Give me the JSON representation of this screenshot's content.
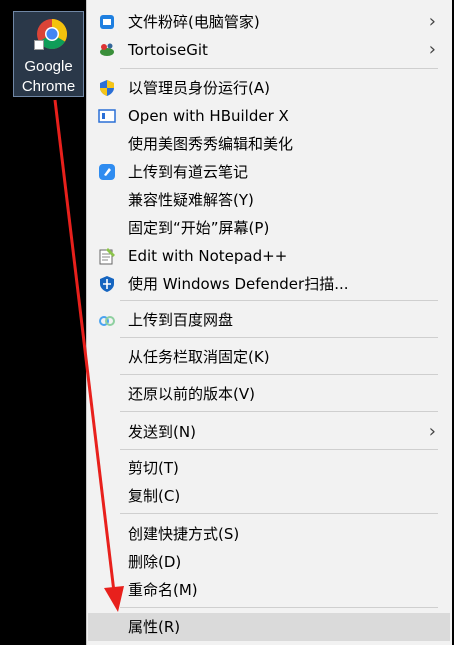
{
  "desktop": {
    "shortcut_label_line1": "Google",
    "shortcut_label_line2": "Chrome",
    "shortcut_icon": "chrome-icon"
  },
  "menu": {
    "items": [
      {
        "label": "文件粉碎(电脑管家)",
        "icon": "shred-icon",
        "submenu": true
      },
      {
        "label": "TortoiseGit",
        "icon": "tortoisegit-icon",
        "submenu": true
      },
      {
        "label": "以管理员身份运行(A)",
        "icon": "shield-icon"
      },
      {
        "label": "Open with HBuilder X",
        "icon": "hbuilder-icon"
      },
      {
        "label": "使用美图秀秀编辑和美化"
      },
      {
        "label": "上传到有道云笔记",
        "icon": "youdao-icon"
      },
      {
        "label": "兼容性疑难解答(Y)"
      },
      {
        "label": "固定到“开始”屏幕(P)"
      },
      {
        "label": "Edit with Notepad++",
        "icon": "notepad-icon"
      },
      {
        "label": "使用 Windows Defender扫描...",
        "icon": "defender-icon"
      },
      {
        "label": "上传到百度网盘",
        "icon": "baidu-icon"
      },
      {
        "label": "从任务栏取消固定(K)"
      },
      {
        "label": "还原以前的版本(V)"
      },
      {
        "label": "发送到(N)",
        "submenu": true
      },
      {
        "label": "剪切(T)"
      },
      {
        "label": "复制(C)"
      },
      {
        "label": "创建快捷方式(S)"
      },
      {
        "label": "删除(D)"
      },
      {
        "label": "重命名(M)"
      },
      {
        "label": "属性(R)",
        "highlighted": true
      }
    ],
    "submenu_glyph": "›"
  },
  "annotation": {
    "arrow_color": "#e8201c"
  }
}
